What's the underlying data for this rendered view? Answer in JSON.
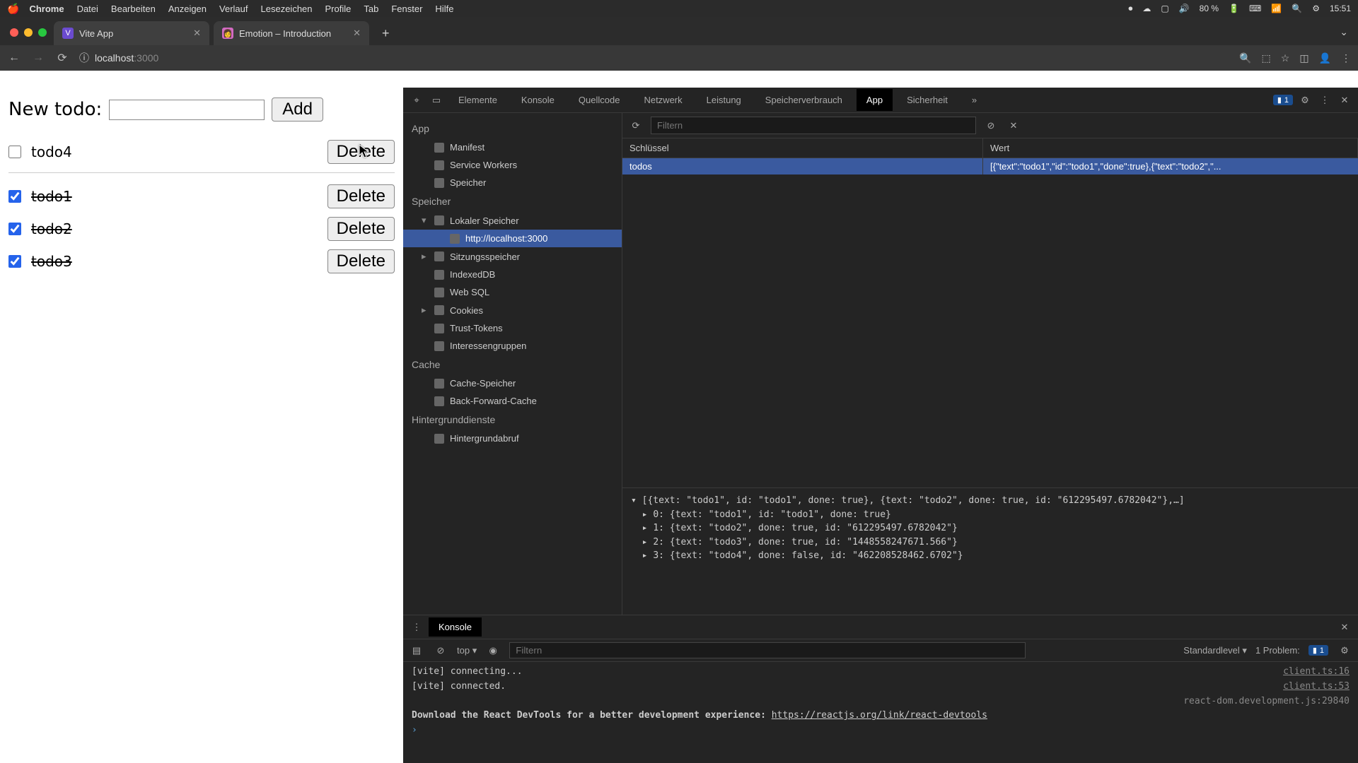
{
  "menubar": {
    "app": "Chrome",
    "items": [
      "Datei",
      "Bearbeiten",
      "Anzeigen",
      "Verlauf",
      "Lesezeichen",
      "Profile",
      "Tab",
      "Fenster",
      "Hilfe"
    ],
    "status": {
      "battery": "80 %",
      "time": "15:51"
    }
  },
  "tabs": [
    {
      "title": "Vite App",
      "fav_bg": "#6b4bd0",
      "fav_char": "V",
      "active": true
    },
    {
      "title": "Emotion – Introduction",
      "fav_bg": "#d36ac2",
      "fav_char": "👩",
      "active": false
    }
  ],
  "url": {
    "host": "localhost",
    "path": ":3000"
  },
  "todo": {
    "label": "New todo:",
    "add": "Add",
    "delete": "Delete",
    "unchecked": [
      {
        "text": "todo4"
      }
    ],
    "checked": [
      {
        "text": "todo1"
      },
      {
        "text": "todo2"
      },
      {
        "text": "todo3"
      }
    ]
  },
  "devtools": {
    "tabs": [
      "Elemente",
      "Konsole",
      "Quellcode",
      "Netzwerk",
      "Leistung",
      "Speicherverbrauch",
      "App",
      "Sicherheit"
    ],
    "active_tab": "App",
    "more": "»",
    "issue_count": "1",
    "side": {
      "app": {
        "label": "App",
        "items": [
          "Manifest",
          "Service Workers",
          "Speicher"
        ]
      },
      "storage": {
        "label": "Speicher",
        "local": {
          "label": "Lokaler Speicher",
          "origin": "http://localhost:3000"
        },
        "session": "Sitzungsspeicher",
        "indexed": "IndexedDB",
        "websql": "Web SQL",
        "cookies": "Cookies",
        "trust": "Trust-Tokens",
        "interest": "Interessengruppen"
      },
      "cache": {
        "label": "Cache",
        "items": [
          "Cache-Speicher",
          "Back-Forward-Cache"
        ]
      },
      "bg": {
        "label": "Hintergrunddienste",
        "items": [
          "Hintergrundabruf"
        ]
      }
    },
    "filter_placeholder": "Filtern",
    "table": {
      "col_key": "Schlüssel",
      "col_val": "Wert",
      "row_key": "todos",
      "row_val": "[{\"text\":\"todo1\",\"id\":\"todo1\",\"done\":true},{\"text\":\"todo2\",\"..."
    },
    "preview": {
      "summary": "[{text: \"todo1\", id: \"todo1\", done: true}, {text: \"todo2\", done: true, id: \"612295497.6782042\"},…]",
      "rows": [
        "0: {text: \"todo1\", id: \"todo1\", done: true}",
        "1: {text: \"todo2\", done: true, id: \"612295497.6782042\"}",
        "2: {text: \"todo3\", done: true, id: \"1448558247671.566\"}",
        "3: {text: \"todo4\", done: false, id: \"462208528462.6702\"}"
      ]
    }
  },
  "console": {
    "tab": "Konsole",
    "context": "top",
    "filter_placeholder": "Filtern",
    "level": "Standardlevel",
    "problem_label": "1 Problem:",
    "problem_count": "1",
    "lines": [
      {
        "msg": "[vite] connecting...",
        "src": "client.ts:16"
      },
      {
        "msg": "[vite] connected.",
        "src": "client.ts:53"
      }
    ],
    "react_src": "react-dom.development.js:29840",
    "react_msg": "Download the React DevTools for a better development experience: ",
    "react_link": "https://reactjs.org/link/react-devtools"
  }
}
